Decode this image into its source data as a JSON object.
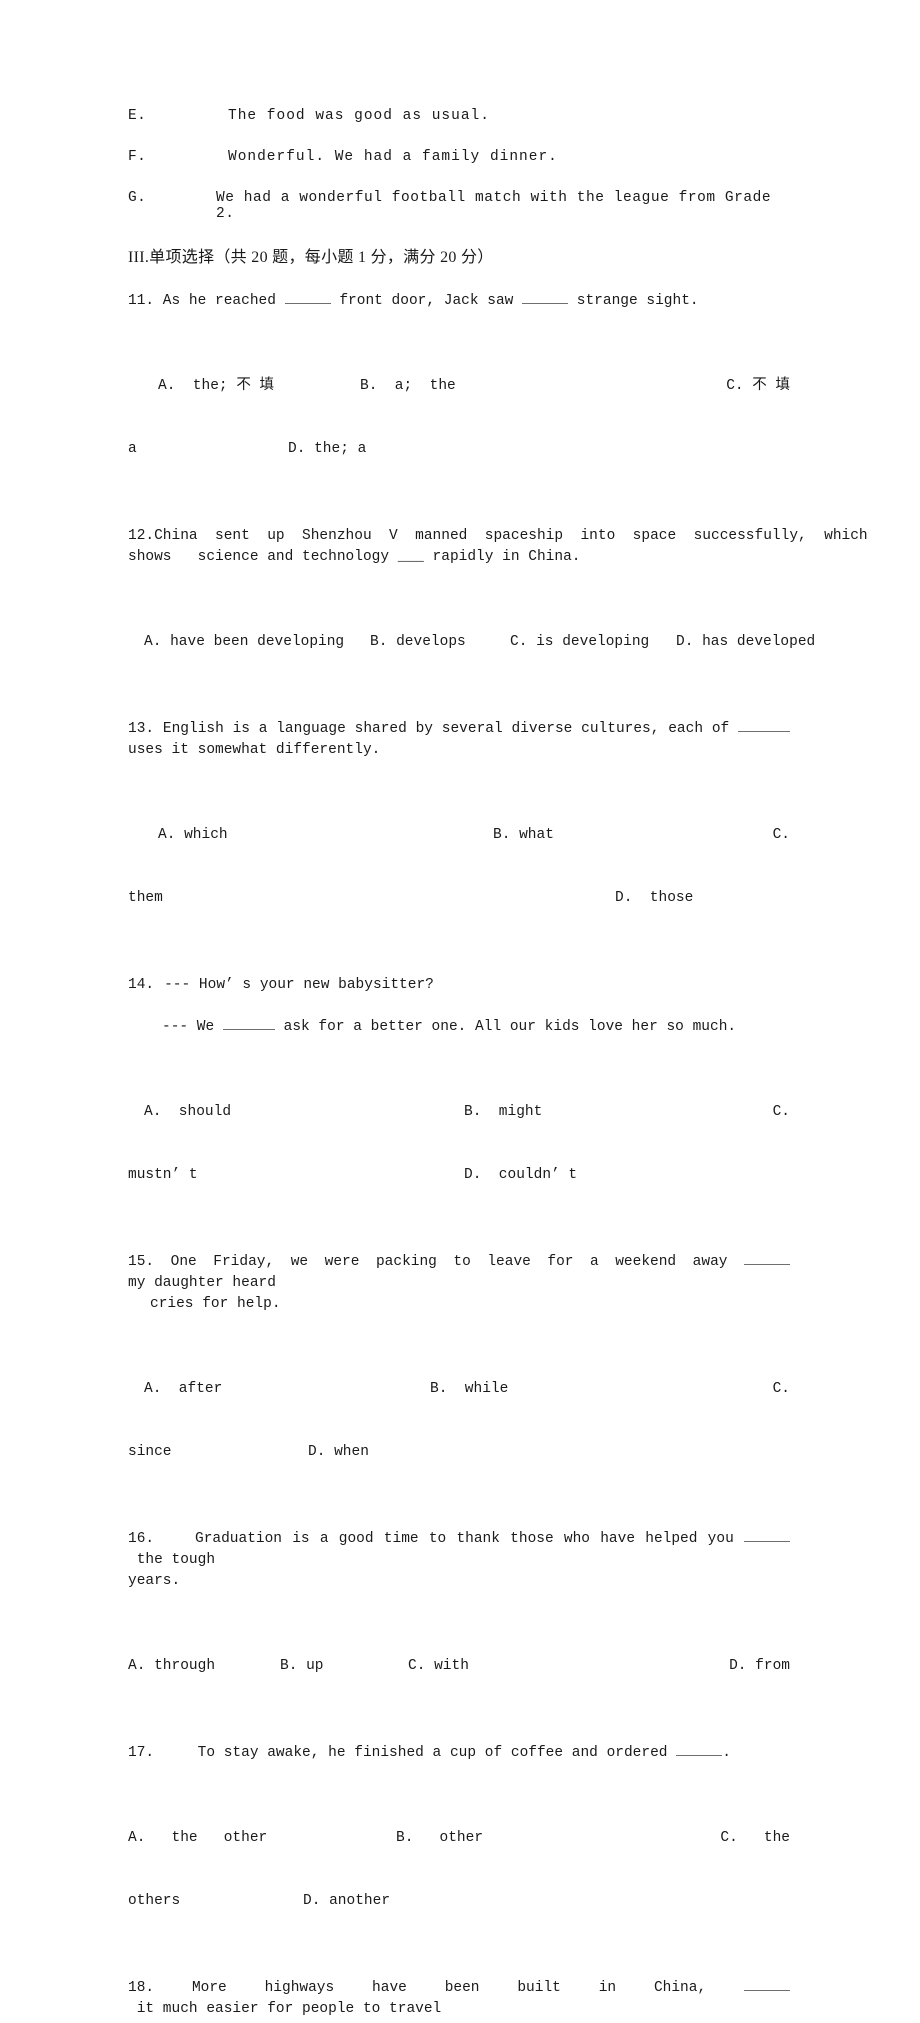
{
  "document": {
    "dialogue_options": [
      {
        "letter": "E.",
        "text": "The food was good as usual."
      },
      {
        "letter": "F.",
        "text": "Wonderful. We had a family dinner."
      },
      {
        "letter": "G.",
        "text": "We had a wonderful football match with the league from Grade 2."
      }
    ],
    "section_heading": "III.单项选择（共 20 题，每小题 1 分，满分 20 分）",
    "questions": [
      {
        "number": "11.",
        "stem_pre": " As he reached ",
        "stem_mid": " front door, Jack saw ",
        "stem_post": " strange sight.",
        "opt_a": "A.  the; 不 填",
        "opt_b": "B.  a;  the",
        "opt_c": "C. 不 填",
        "opt_c_wrap": "a",
        "opt_d": "D. the; a"
      },
      {
        "number": "12.",
        "stem_line1": "China  sent  up  Shenzhou  V  manned  spaceship  into  space  successfully,  which",
        "stem_line2": "shows   science and technology ___ rapidly in China.",
        "opt_a": "A. have been developing",
        "opt_b": "B. develops",
        "opt_c": "C. is developing",
        "opt_d": "D. has developed"
      },
      {
        "number": "13.",
        "stem_pre": " English is a language shared by several diverse cultures, each of ",
        "stem_post": " uses it somewhat differently.",
        "opt_a": "A. which",
        "opt_b": "B. what",
        "opt_c": "C.",
        "opt_c_wrap": "them",
        "opt_d": "D.  those"
      },
      {
        "number": "14.",
        "stem_line1": "--- How’ s your new babysitter?",
        "stem_line2_pre": "--- We ",
        "stem_line2_post": " ask for a better one. All our kids love her so much.",
        "opt_a": "A.  should",
        "opt_b": "B.  might",
        "opt_c": "C.",
        "opt_c_wrap": "mustn’ t",
        "opt_d": "D.  couldn’ t"
      },
      {
        "number": "15.",
        "stem_pre": " One Friday, we were packing to leave for a weekend away ",
        "stem_post": "my daughter heard",
        "stem_line2": "cries for help.",
        "opt_a": "A.  after",
        "opt_b": "B.  while",
        "opt_c": "C.",
        "opt_c_wrap": "since",
        "opt_d": "D. when"
      },
      {
        "number": "16.",
        "stem_pre": "    Graduation is a good time to thank those who have helped you ",
        "stem_post": " the tough",
        "stem_line2": "years.",
        "opt_a": "A. through",
        "opt_b": "B. up",
        "opt_c": "C. with",
        "opt_d": "D. from"
      },
      {
        "number": "17.",
        "stem_pre": "     To stay awake, he finished a cup of coffee and ordered ",
        "stem_post": ".",
        "opt_a": "A.   the   other",
        "opt_b": "B.   other",
        "opt_c": "C.   the",
        "opt_c_wrap": "others",
        "opt_d": "D. another"
      },
      {
        "number": "18.",
        "stem_pre": " More highways have been built in China, ",
        "stem_post": " it much easier for people to travel"
      }
    ]
  }
}
